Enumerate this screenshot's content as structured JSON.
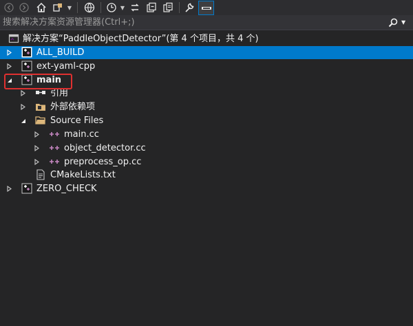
{
  "search": {
    "placeholder": "搜索解决方案资源管理器(Ctrl+;)"
  },
  "solution": {
    "label": "解决方案“PaddleObjectDetector”(第 4 个项目，共 4 个)"
  },
  "tree": {
    "all_build": "ALL_BUILD",
    "ext_yaml": "ext-yaml-cpp",
    "main": "main",
    "references": "引用",
    "external_deps": "外部依赖项",
    "source_files": "Source Files",
    "main_cc": "main.cc",
    "object_detector": "object_detector.cc",
    "preprocess": "preprocess_op.cc",
    "cmakelists": "CMakeLists.txt",
    "zero_check": "ZERO_CHECK"
  },
  "selected_item": "ALL_BUILD",
  "highlighted_item": "main",
  "colors": {
    "selection": "#007acc",
    "highlight_border": "#e03030",
    "background": "#252526"
  }
}
